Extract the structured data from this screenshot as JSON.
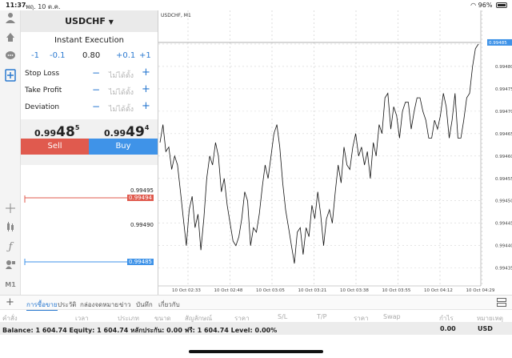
{
  "status": {
    "time": "11:37",
    "date": "พฤ. 10 ต.ค.",
    "battery": "96%"
  },
  "order": {
    "symbol": "USDCHF",
    "execution": "Instant Execution",
    "steps": [
      "-1",
      "-0.1",
      "0.80",
      "+0.1",
      "+1"
    ],
    "params": [
      {
        "label": "Stop Loss",
        "value": "ไม่ได้ตั้ง"
      },
      {
        "label": "Take Profit",
        "value": "ไม่ได้ตั้ง"
      },
      {
        "label": "Deviation",
        "value": "ไม่ได้ตั้ง"
      }
    ],
    "sell": {
      "prefix": "0.99",
      "big": "48",
      "sup": "5",
      "label": "Sell"
    },
    "buy": {
      "prefix": "0.99",
      "big": "49",
      "sup": "4",
      "label": "Buy"
    }
  },
  "mini_chart": {
    "levels": [
      "0.99495",
      "0.99494",
      "0.99490",
      "0.99485"
    ]
  },
  "left_icons": [
    "user-icon",
    "trade-icon",
    "chat-icon",
    "add-order-icon",
    "crosshair-icon",
    "indicators-icon",
    "function-icon",
    "objects-icon",
    "timeframe-label"
  ],
  "timeframe": "M1",
  "chart_title": "USDCHF, M1",
  "chart_data": {
    "type": "line",
    "title": "USDCHF, M1",
    "y_ticks": [
      "0.99485",
      "0.99480",
      "0.99475",
      "0.99470",
      "0.99465",
      "0.99460",
      "0.99455",
      "0.99450",
      "0.99445",
      "0.99440",
      "0.99435"
    ],
    "x_ticks": [
      "10 Oct 02:33",
      "10 Oct 02:48",
      "10 Oct 03:05",
      "10 Oct 03:21",
      "10 Oct 03:38",
      "10 Oct 03:55",
      "10 Oct 04:12",
      "10 Oct 04:29"
    ],
    "ylim": [
      0.99431,
      0.9949
    ],
    "current_price": "0.99485",
    "values": [
      0.99463,
      0.99467,
      0.99461,
      0.99462,
      0.99457,
      0.9946,
      0.99458,
      0.99452,
      0.99446,
      0.9944,
      0.99448,
      0.99451,
      0.99444,
      0.99447,
      0.99439,
      0.99446,
      0.99455,
      0.9946,
      0.99458,
      0.99463,
      0.9946,
      0.99452,
      0.99455,
      0.99449,
      0.99445,
      0.99441,
      0.9944,
      0.99442,
      0.99446,
      0.99452,
      0.9945,
      0.9944,
      0.99444,
      0.99443,
      0.99447,
      0.99453,
      0.99458,
      0.99455,
      0.9946,
      0.99465,
      0.99467,
      0.99462,
      0.99454,
      0.99448,
      0.99444,
      0.9944,
      0.99436,
      0.99443,
      0.99444,
      0.99438,
      0.99444,
      0.99442,
      0.99449,
      0.99446,
      0.99452,
      0.99447,
      0.9944,
      0.99446,
      0.99448,
      0.99445,
      0.99452,
      0.99458,
      0.99454,
      0.99462,
      0.99458,
      0.99457,
      0.99462,
      0.99465,
      0.9946,
      0.99462,
      0.99458,
      0.99461,
      0.99455,
      0.99463,
      0.9946,
      0.99467,
      0.99465,
      0.99473,
      0.99474,
      0.99466,
      0.99471,
      0.99469,
      0.99464,
      0.9947,
      0.99472,
      0.99472,
      0.99466,
      0.9947,
      0.99473,
      0.99473,
      0.9947,
      0.99468,
      0.99464,
      0.99464,
      0.99468,
      0.99466,
      0.99469,
      0.99474,
      0.99471,
      0.99464,
      0.99468,
      0.99474,
      0.99464,
      0.99464,
      0.99468,
      0.99473,
      0.99474,
      0.9948,
      0.99484,
      0.99485
    ]
  },
  "tabs": [
    "การซื้อขาย",
    "ประวัติ",
    "กล่องจดหมาย",
    "ข่าว",
    "บันทึก",
    "เกี่ยวกับ"
  ],
  "table_headers": [
    "คำสั่ง",
    "เวลา",
    "ประเภท",
    "ขนาด",
    "สัญลักษณ์",
    "ราคา",
    "S/L",
    "T/P",
    "ราคา",
    "Swap",
    "กำไร",
    "หมายเหตุ"
  ],
  "balance": {
    "text": "Balance: 1 604.74  Equity: 1 604.74  หลักประกัน: 0.00  ฟรี: 1 604.74  Level: 0.00%",
    "profit": "0.00",
    "currency": "USD"
  }
}
